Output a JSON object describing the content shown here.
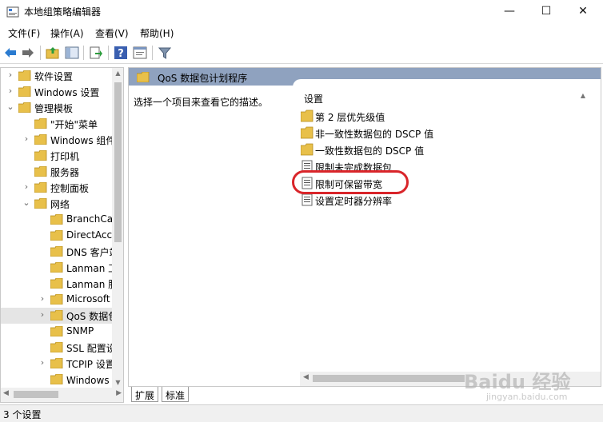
{
  "window": {
    "title": "本地组策略编辑器",
    "minimize_glyph": "—",
    "maximize_glyph": "☐",
    "close_glyph": "✕"
  },
  "menu": [
    "文件(F)",
    "操作(A)",
    "查看(V)",
    "帮助(H)"
  ],
  "toolbar": {
    "icons": [
      "back-arrow-icon",
      "forward-arrow-icon",
      "up-folder-icon",
      "show-hide-tree-icon",
      "export-list-icon",
      "help-icon",
      "properties-icon",
      "filter-icon"
    ]
  },
  "tree": {
    "items": [
      {
        "label": "软件设置",
        "twisty": "›"
      },
      {
        "label": "Windows 设置",
        "twisty": "›"
      },
      {
        "label": "管理模板",
        "twisty": "⌄"
      },
      {
        "label": "\"开始\"菜单",
        "twisty": ""
      },
      {
        "label": "Windows 组件",
        "twisty": "›"
      },
      {
        "label": "打印机",
        "twisty": ""
      },
      {
        "label": "服务器",
        "twisty": ""
      },
      {
        "label": "控制面板",
        "twisty": "›"
      },
      {
        "label": "网络",
        "twisty": "⌄"
      },
      {
        "label": "BranchCache",
        "twisty": ""
      },
      {
        "label": "DirectAccess",
        "twisty": ""
      },
      {
        "label": "DNS 客户端",
        "twisty": ""
      },
      {
        "label": "Lanman 工作站",
        "twisty": ""
      },
      {
        "label": "Lanman 服务器",
        "twisty": ""
      },
      {
        "label": "Microsoft",
        "twisty": "›"
      },
      {
        "label": "QoS 数据包计划程序",
        "twisty": "›"
      },
      {
        "label": "SNMP",
        "twisty": ""
      },
      {
        "label": "SSL 配置设置",
        "twisty": ""
      },
      {
        "label": "TCPIP 设置",
        "twisty": "›"
      },
      {
        "label": "Windows 连接管理器",
        "twisty": ""
      }
    ]
  },
  "detail": {
    "header": "QoS 数据包计划程序",
    "description": "选择一个项目来查看它的描述。",
    "column": "设置",
    "settings": [
      {
        "label": "第 2 层优先级值",
        "icon": "folder-icon"
      },
      {
        "label": "非一致性数据包的 DSCP 值",
        "icon": "folder-icon"
      },
      {
        "label": "一致性数据包的 DSCP 值",
        "icon": "folder-icon"
      },
      {
        "label": "限制未完成数据包",
        "icon": "policy-setting-icon"
      },
      {
        "label": "限制可保留带宽",
        "icon": "policy-setting-icon"
      },
      {
        "label": "设置定时器分辨率",
        "icon": "policy-setting-icon"
      }
    ]
  },
  "tabs": [
    "扩展",
    "标准"
  ],
  "status": "3 个设置",
  "watermark": {
    "text": "Baidu 经验",
    "sub": "jingyan.baidu.com"
  },
  "colors": {
    "header_bar": "#8fa2bf",
    "highlight": "#d9252a",
    "folder": "#e8c04a"
  }
}
